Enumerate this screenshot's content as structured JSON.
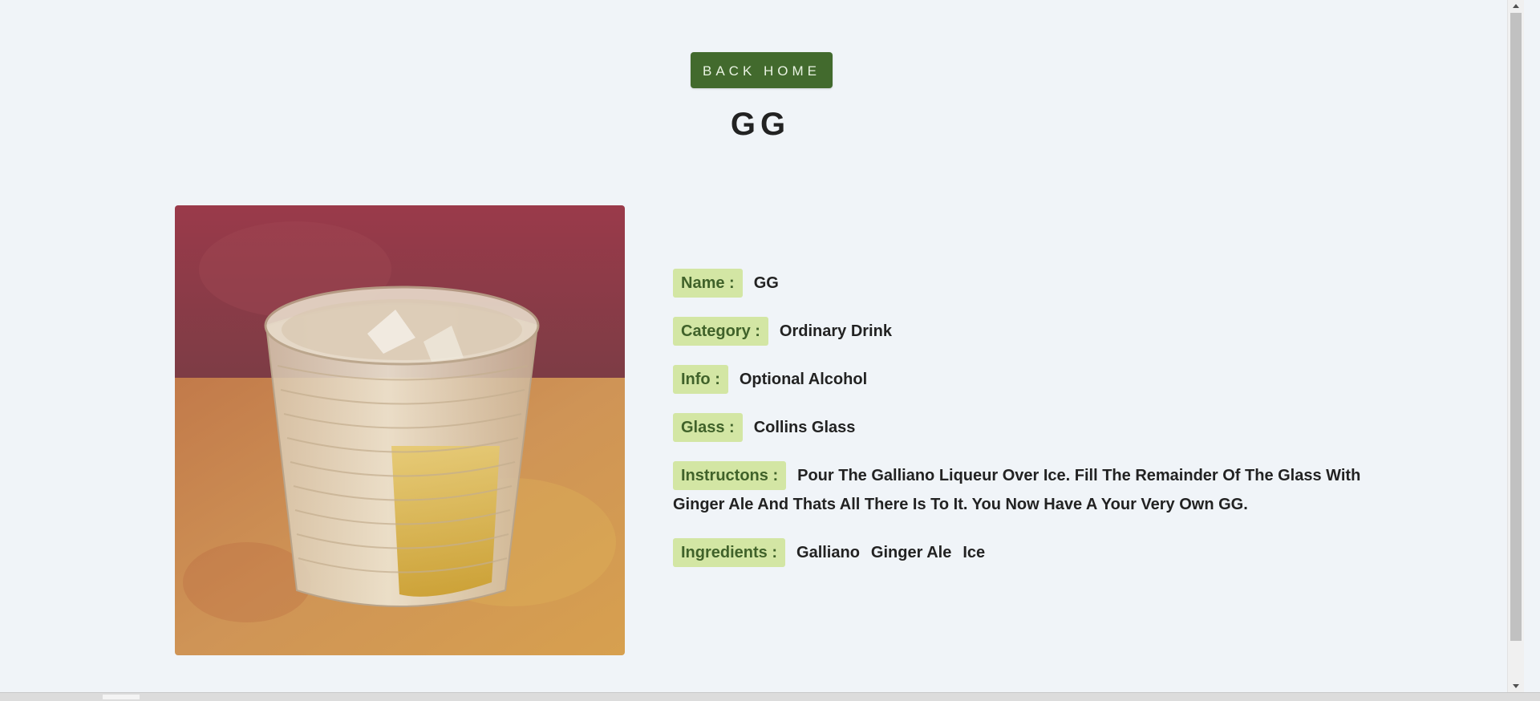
{
  "nav": {
    "back_label": "Back Home"
  },
  "drink": {
    "title": "GG",
    "image_icon": "cocktail-photo-icon",
    "fields": {
      "name_label": "Name :",
      "name_value": "GG",
      "category_label": "Category :",
      "category_value": "Ordinary Drink",
      "info_label": "Info :",
      "info_value": "Optional Alcohol",
      "glass_label": "Glass :",
      "glass_value": "Collins Glass",
      "instructions_label": "Instructons :",
      "instructions_value": "Pour The Galliano Liqueur Over Ice. Fill The Remainder Of The Glass With Ginger Ale And Thats All There Is To It. You Now Have A Your Very Own GG.",
      "ingredients_label": "Ingredients :",
      "ingredients": [
        "Galliano",
        "Ginger Ale",
        "Ice"
      ]
    }
  },
  "colors": {
    "button": "#426a2d",
    "label_bg": "#d3e6a4",
    "label_text": "#40622a",
    "page_bg": "#f0f4f8"
  }
}
